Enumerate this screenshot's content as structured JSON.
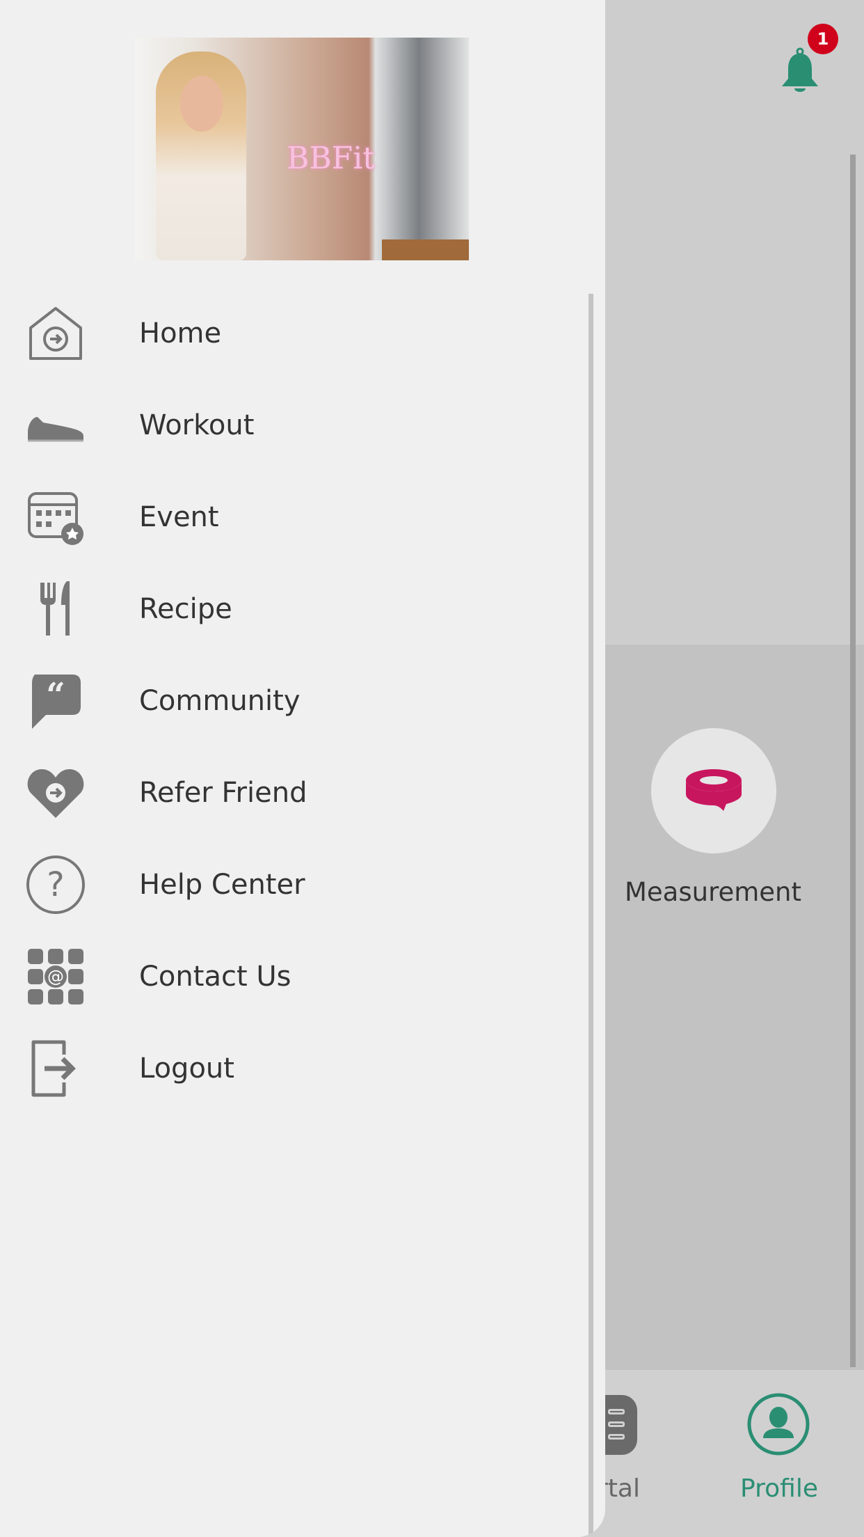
{
  "header": {
    "notification_count": "1",
    "bell_color": "#2a8e73",
    "badge_color": "#d0021b"
  },
  "main": {
    "measurement_label": "Measurement",
    "measurement_icon": "measuring-tape-icon",
    "accent": "#c8165e"
  },
  "bottom_nav": {
    "items": [
      {
        "label": "rtal",
        "icon": "portal-icon"
      },
      {
        "label": "Profile",
        "icon": "profile-icon",
        "active": true
      }
    ],
    "active_color": "#2a8e73"
  },
  "drawer": {
    "items": [
      {
        "label": "Home",
        "icon": "home-icon"
      },
      {
        "label": "Workout",
        "icon": "sneaker-icon"
      },
      {
        "label": "Event",
        "icon": "calendar-icon"
      },
      {
        "label": "Recipe",
        "icon": "fork-knife-icon"
      },
      {
        "label": "Community",
        "icon": "quote-bubble-icon"
      },
      {
        "label": "Refer Friend",
        "icon": "heart-arrow-icon"
      },
      {
        "label": "Help Center",
        "icon": "question-icon"
      },
      {
        "label": "Contact Us",
        "icon": "at-icon"
      },
      {
        "label": "Logout",
        "icon": "logout-icon"
      }
    ],
    "photo_sign": "BBFit"
  }
}
